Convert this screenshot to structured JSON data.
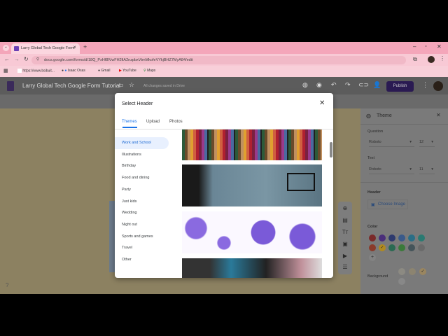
{
  "browser": {
    "tab_title": "Larry Global Tech Google Form",
    "url": "docs.google.com/forms/d/18Q_PxHf8lVwFH2fiA2nzpbxVtmMkofeVYkjBHZ7MyA84/edit",
    "bookmarks": [
      "https://www.bsibuit...",
      "Isaac Osas",
      "Gmail",
      "YouTube",
      "Maps"
    ]
  },
  "forms": {
    "title": "Larry Global Tech Google Form Tutorial",
    "save_status": "All changes saved in Drive",
    "publish_label": "Publish"
  },
  "dialog": {
    "title": "Select Header",
    "tabs": [
      "Themes",
      "Upload",
      "Photos"
    ],
    "active_tab": "Themes",
    "categories": [
      "Work and School",
      "Illustrations",
      "Birthday",
      "Food and dining",
      "Party",
      "Just kids",
      "Wedding",
      "Night out",
      "Sports and games",
      "Travel",
      "Other"
    ],
    "selected_category": "Work and School"
  },
  "theme_panel": {
    "title": "Theme",
    "question_label": "Question",
    "question_font": "Roboto",
    "question_size": "12",
    "text_label": "Text",
    "text_font": "Roboto",
    "text_size": "11",
    "header_label": "Header",
    "choose_image": "Choose Image",
    "color_label": "Color",
    "background_label": "Background",
    "colors": [
      "#7a2a2a",
      "#4a2e7a",
      "#2e3a6e",
      "#3a5a8a",
      "#2a6e86",
      "#2a7a72",
      "#8a3a2a",
      "#b08a20",
      "#2a6a52",
      "#3a7a3a",
      "#44545a",
      "#6a6a6a"
    ],
    "backgrounds": [
      "#8c8a82",
      "#8c8470",
      "#9a8660",
      "#888888"
    ]
  }
}
